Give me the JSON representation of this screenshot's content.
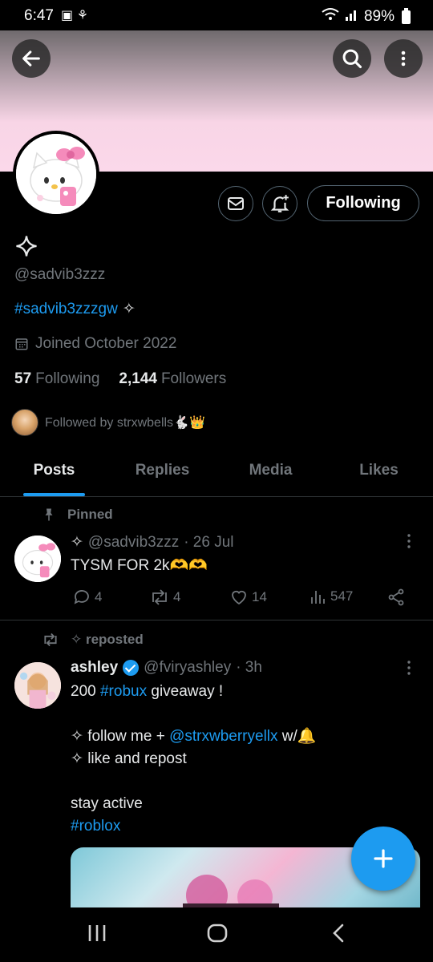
{
  "status_bar": {
    "time": "6:47",
    "battery": "89%"
  },
  "header": {
    "back_label": "back",
    "search_label": "search",
    "more_label": "more"
  },
  "profile": {
    "display_name": "✧",
    "handle": "@sadvib3zzz",
    "bio_tag": "#sadvib3zzzgw",
    "bio_sparkle": "✧",
    "joined": "Joined October 2022",
    "following_count": "57",
    "following_label": "Following",
    "followers_count": "2,144",
    "followers_label": "Followers",
    "followed_by": "Followed by strxwbells🐇👑",
    "follow_button": "Following"
  },
  "tabs": [
    "Posts",
    "Replies",
    "Media",
    "Likes"
  ],
  "tweets": [
    {
      "context": "Pinned",
      "name_sparkle": "✧",
      "handle": "@sadvib3zzz",
      "time": "· 26 Jul",
      "text": "TYSM FOR 2k🫶🫶",
      "replies": "4",
      "reposts": "4",
      "likes": "14",
      "views": "547"
    },
    {
      "context": "✧ reposted",
      "name": "ashley",
      "handle": "@fviryashley",
      "time": "· 3h",
      "line1_pre": "200 ",
      "line1_tag": "#robux",
      "line1_post": " giveaway !",
      "line2_pre": "✧ follow me + ",
      "line2_mention": "@strxwberryellx",
      "line2_post": " w/🔔",
      "line3": "✧ like and repost",
      "line4": "stay active",
      "line5_tag": "#roblox"
    }
  ],
  "fab_label": "+",
  "colors": {
    "accent": "#1d9bf0",
    "banner": "#fbd8ea",
    "muted": "#71767b"
  }
}
